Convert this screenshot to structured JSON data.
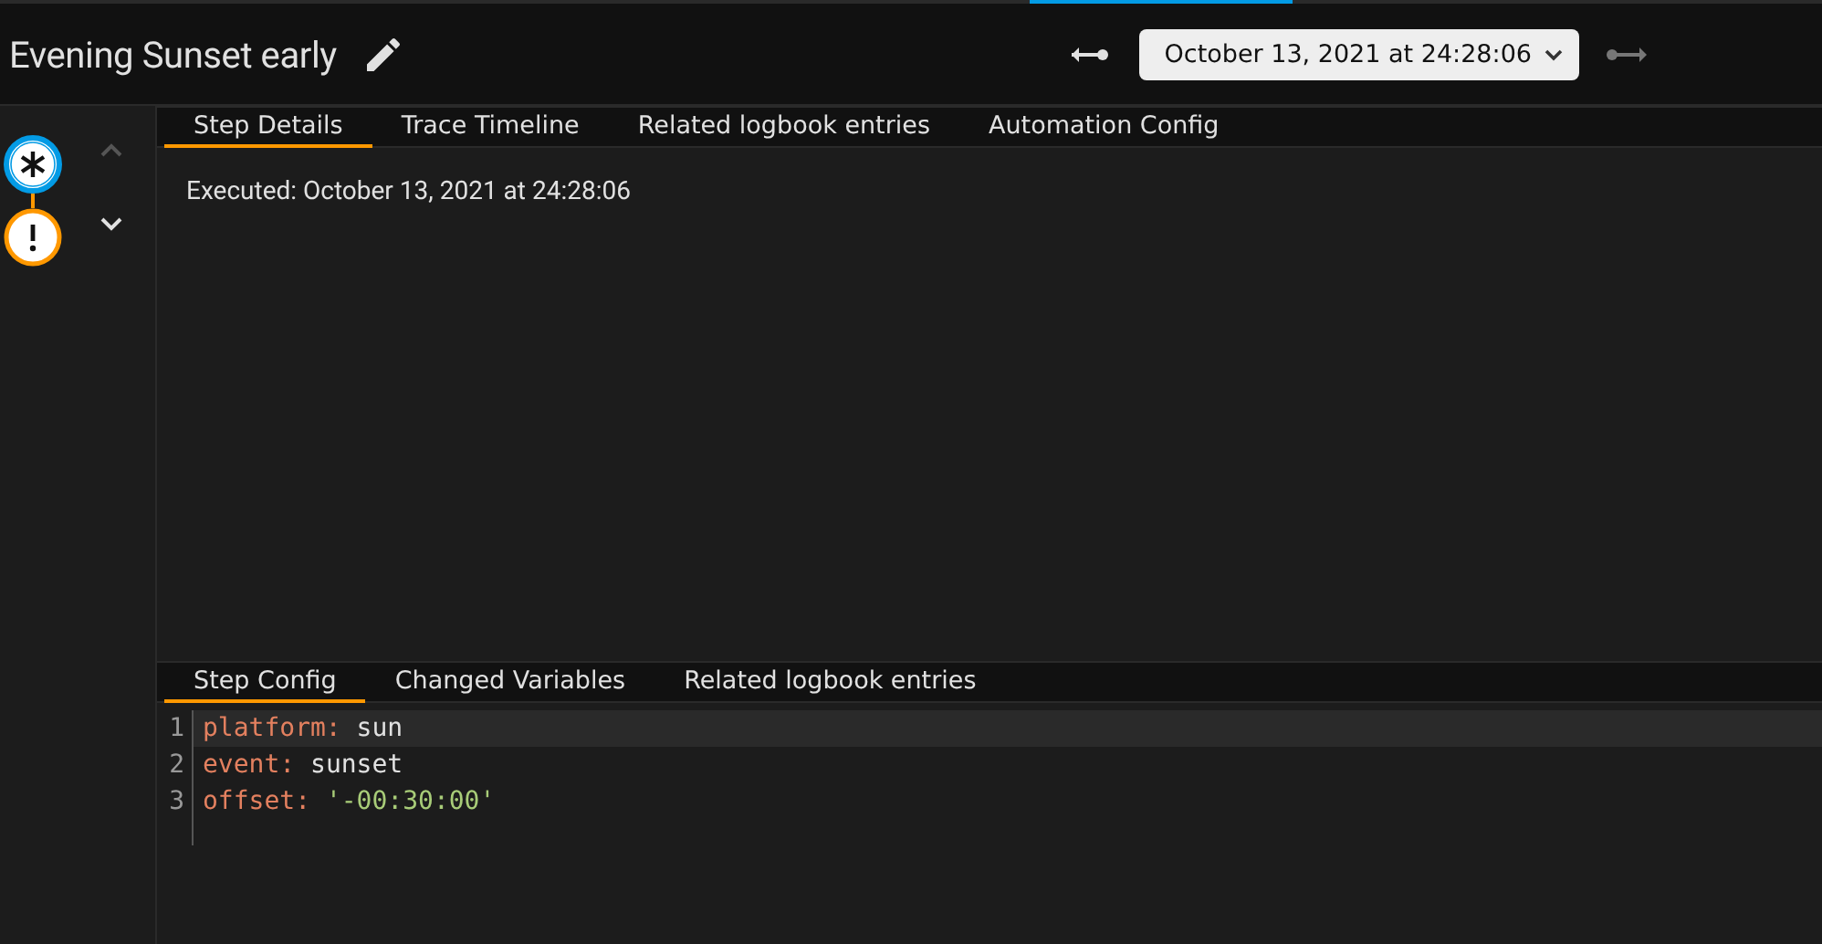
{
  "header": {
    "indicator_on": true,
    "title": "Evening Sunset early",
    "trace_picker": {
      "value": "October 13, 2021 at 24:28:06"
    },
    "previous_disabled": false,
    "next_disabled": true
  },
  "graph": {
    "nodes": [
      {
        "kind": "trigger",
        "color": "#039be5",
        "selected": true
      },
      {
        "kind": "condition",
        "color": "#ff9800",
        "selected": false
      }
    ],
    "up_disabled": true,
    "down_disabled": false
  },
  "tabs": [
    {
      "label": "Step Details",
      "selected": true
    },
    {
      "label": "Trace Timeline",
      "selected": false
    },
    {
      "label": "Related logbook entries",
      "selected": false
    },
    {
      "label": "Automation Config",
      "selected": false
    }
  ],
  "step_details": {
    "executed": "Executed: October 13, 2021 at 24:28:06"
  },
  "lower_tabs": [
    {
      "label": "Step Config",
      "selected": true
    },
    {
      "label": "Changed Variables",
      "selected": false
    },
    {
      "label": "Related logbook entries",
      "selected": false
    }
  ],
  "code": {
    "lines": [
      {
        "number": "1",
        "key": "platform:",
        "value": "sun",
        "kind": "plain",
        "active": true
      },
      {
        "number": "2",
        "key": "event:",
        "value": "sunset",
        "kind": "plain",
        "active": false
      },
      {
        "number": "3",
        "key": "offset:",
        "value": "'-00:30:00'",
        "kind": "string",
        "active": false
      }
    ]
  }
}
